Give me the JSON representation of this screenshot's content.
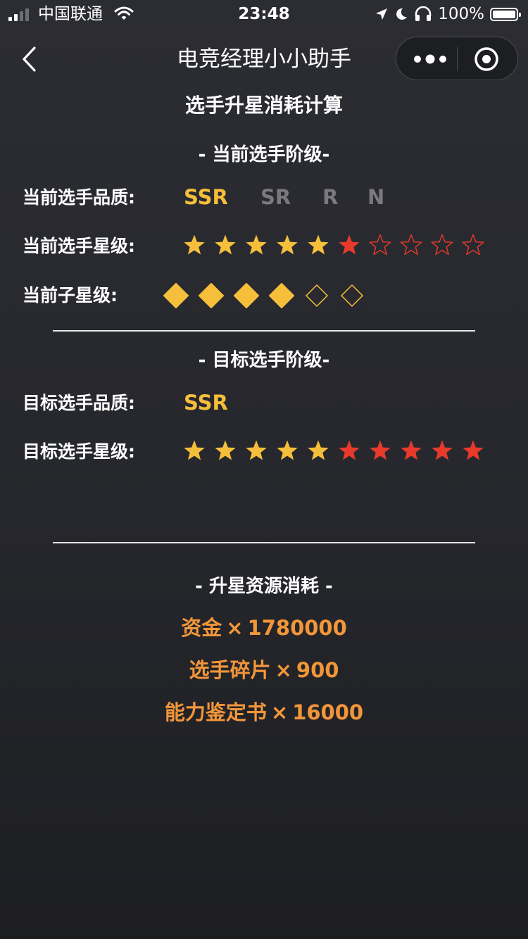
{
  "status_bar": {
    "carrier": "中国联通",
    "time": "23:48",
    "battery": "100%"
  },
  "nav": {
    "title": "电竞经理小小助手"
  },
  "page": {
    "title": "选手升星消耗计算"
  },
  "current": {
    "heading": "- 当前选手阶级-",
    "quality_label": "当前选手品质:",
    "qualities": [
      "SSR",
      "SR",
      "R",
      "N"
    ],
    "selected_quality": "SSR",
    "star_label": "当前选手星级:",
    "stars_total": 10,
    "stars_gold": 5,
    "stars_red": 1,
    "substar_label": "当前子星级:",
    "substars_total": 6,
    "substars_filled": 4
  },
  "target": {
    "heading": "- 目标选手阶级-",
    "quality_label": "目标选手品质:",
    "quality": "SSR",
    "star_label": "目标选手星级:",
    "stars_total": 10,
    "stars_gold": 5,
    "stars_red": 5
  },
  "cost": {
    "heading": "- 升星资源消耗 -",
    "multiplier_symbol": "×",
    "items": [
      {
        "name": "资金",
        "amount": "1780000"
      },
      {
        "name": "选手碎片",
        "amount": "900"
      },
      {
        "name": "能力鉴定书",
        "amount": "16000"
      }
    ]
  },
  "colors": {
    "gold": "#f6bf3b",
    "red": "#e83a2b",
    "inactive": "#7a7a7e",
    "cost": "#f2963a"
  },
  "icons": [
    "back-chevron-icon",
    "more-dots-icon",
    "target-circle-icon",
    "wifi-icon",
    "location-arrow-icon",
    "moon-icon",
    "headphones-icon",
    "battery-icon"
  ]
}
